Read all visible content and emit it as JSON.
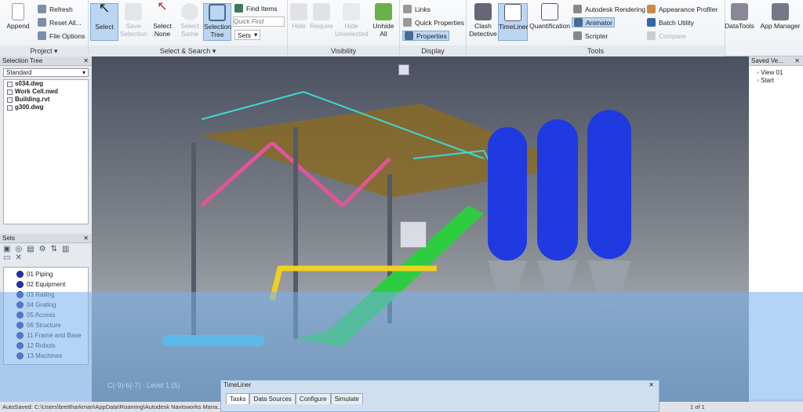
{
  "ribbon": {
    "project": {
      "append": "Append",
      "refresh": "Refresh",
      "reset_all": "Reset All...",
      "file_options": "File Options",
      "label": "Project ▾"
    },
    "select_search": {
      "select": "Select",
      "save_selection": "Save Selection",
      "select_none": "Select None",
      "select_same": "Select Same",
      "selection_tree": "Selection Tree",
      "find_items": "Find Items",
      "quick_find_placeholder": "Quick Find",
      "sets": "Sets",
      "label": "Select & Search ▾"
    },
    "visibility": {
      "hide": "Hide",
      "require": "Require",
      "hide_unselected": "Hide Unselected",
      "unhide_all": "Unhide All",
      "label": "Visibility"
    },
    "display": {
      "links": "Links",
      "quick_properties": "Quick Properties",
      "properties": "Properties",
      "label": "Display"
    },
    "tools": {
      "clash_detective": "Clash Detective",
      "timeliner": "TimeLiner",
      "quantification": "Quantification",
      "autodesk_rendering": "Autodesk Rendering",
      "animator": "Animator",
      "scripter": "Scripter",
      "appearance_profiler": "Appearance Profiler",
      "batch_utility": "Batch Utility",
      "compare": "Compare",
      "label": "Tools"
    },
    "datatools": "DataTools",
    "app_manager": "App Manager"
  },
  "selection_tree": {
    "title": "Selection Tree",
    "mode": "Standard",
    "items": [
      "s034.dwg",
      "Work Cell.nwd",
      "Building.rvt",
      "g300.dwg"
    ]
  },
  "sets": {
    "title": "Sets",
    "items": [
      "01 Piping",
      "02 Equipment",
      "03 Railing",
      "04 Grating",
      "05 Access",
      "06 Structure",
      "11 Frame and Base",
      "12 Robots",
      "13 Machines"
    ]
  },
  "saved_views": {
    "title": "Saved Ve...",
    "items": [
      "View 01",
      "Start"
    ]
  },
  "viewport": {
    "location": "C(-9)-6(-7) : Level 1 (5)"
  },
  "timeliner": {
    "title": "TimeLiner",
    "tabs": [
      "Tasks",
      "Data Sources",
      "Configure",
      "Simulate"
    ]
  },
  "status": {
    "text": "AutoSaved: C:\\Users\\brettharkman\\AppData\\Roaming\\Autodesk Navisworks Mana...",
    "page": "1 of 1"
  }
}
